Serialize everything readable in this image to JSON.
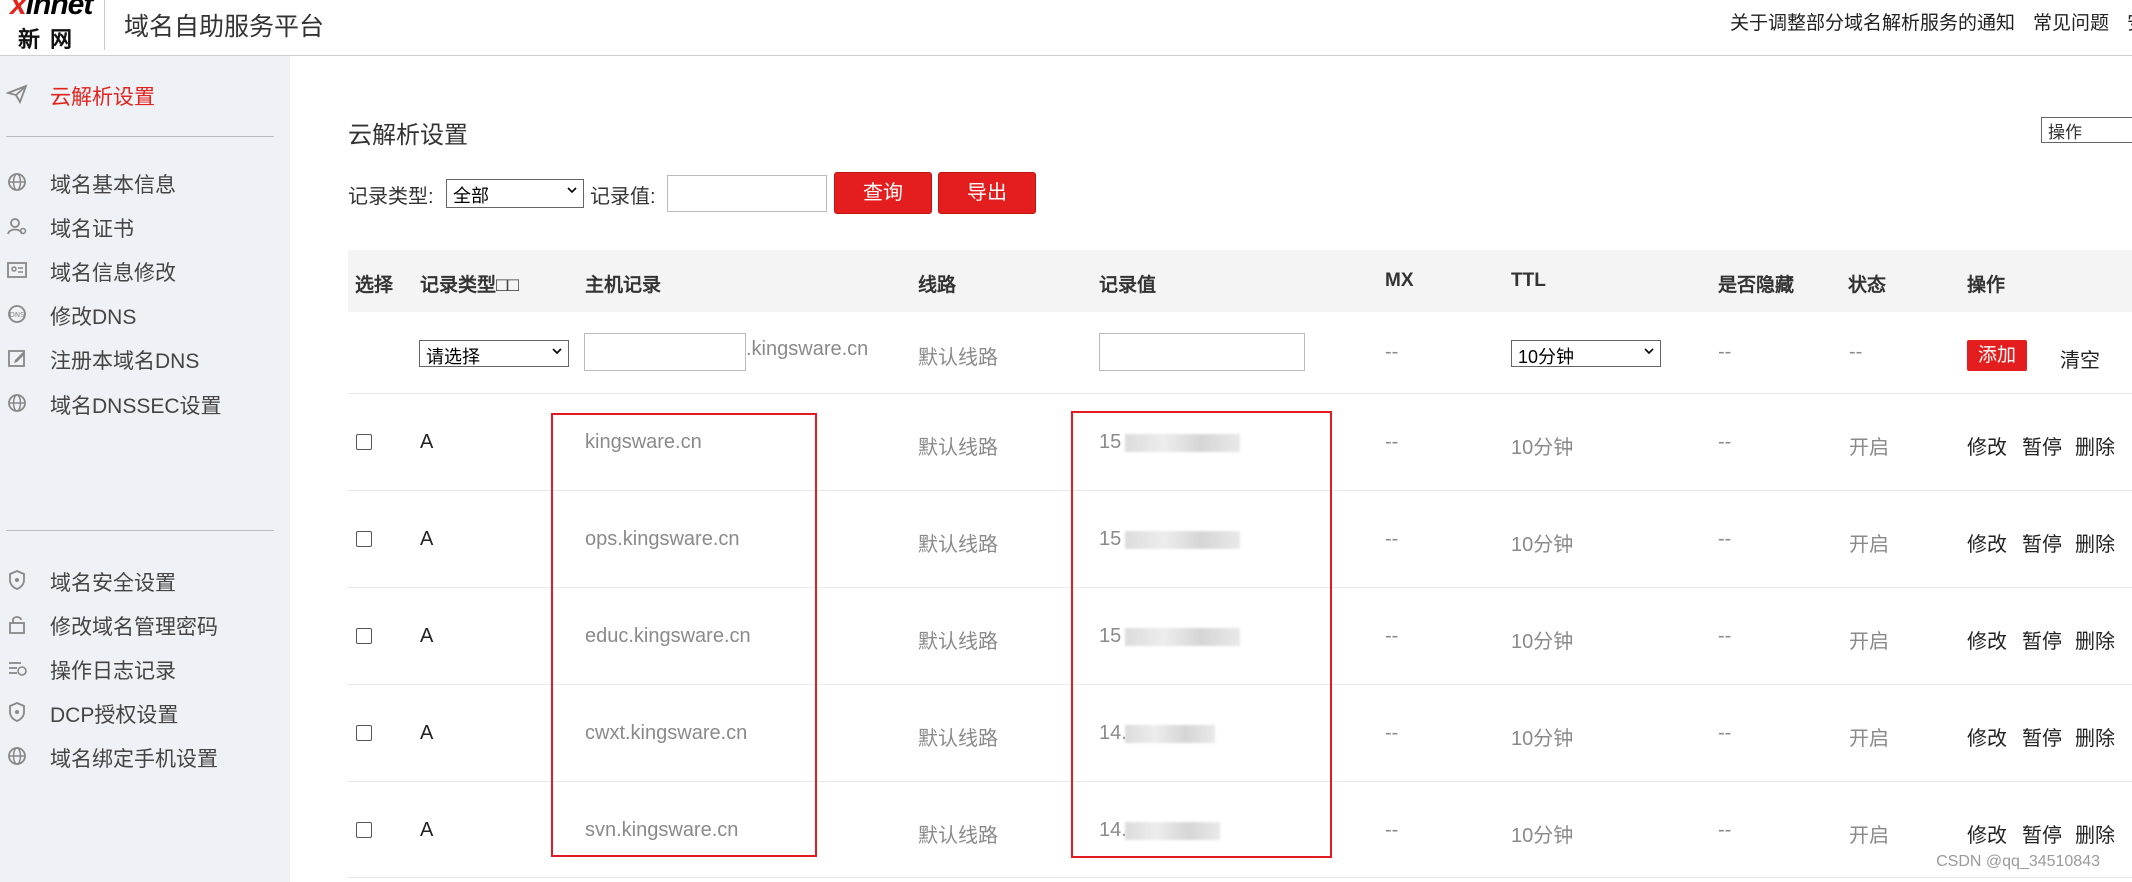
{
  "header": {
    "logo_brand": "xinnet",
    "logo_cn": "新网",
    "title": "域名自助服务平台",
    "links": [
      "关于调整部分域名解析服务的通知",
      "常见问题",
      "安"
    ]
  },
  "sidebar": {
    "items": [
      {
        "label": "云解析设置",
        "icon": "paper-plane-icon",
        "active": true
      },
      {
        "label": "域名基本信息",
        "icon": "globe-icon"
      },
      {
        "label": "域名证书",
        "icon": "user-cert-icon"
      },
      {
        "label": "域名信息修改",
        "icon": "id-card-icon"
      },
      {
        "label": "修改DNS",
        "icon": "dns-icon"
      },
      {
        "label": "注册本域名DNS",
        "icon": "edit-icon"
      },
      {
        "label": "域名DNSSEC设置",
        "icon": "globe-icon"
      },
      {
        "label": "域名安全设置",
        "icon": "shield-icon"
      },
      {
        "label": "修改域名管理密码",
        "icon": "lock-icon"
      },
      {
        "label": "操作日志记录",
        "icon": "log-list-icon"
      },
      {
        "label": "DCP授权设置",
        "icon": "shield-icon"
      },
      {
        "label": "域名绑定手机设置",
        "icon": "globe-icon"
      }
    ]
  },
  "main": {
    "title": "云解析设置",
    "operation_select": "操作",
    "filter": {
      "type_label": "记录类型:",
      "type_value": "全部",
      "value_label": "记录值:",
      "value_input": "",
      "query_button": "查询",
      "export_button": "导出"
    },
    "table": {
      "headers": [
        "选择",
        "记录类型",
        "主机记录",
        "线路",
        "记录值",
        "MX",
        "TTL",
        "是否隐藏",
        "状态",
        "操作"
      ],
      "header_suffix": "□□",
      "new_row": {
        "type_placeholder": "请选择",
        "host_suffix": ".kingsware.cn",
        "line": "默认线路",
        "mx": "--",
        "ttl": "10分钟",
        "hidden": "--",
        "status": "--",
        "add_button": "添加",
        "clear_button": "清空"
      },
      "rows": [
        {
          "type": "A",
          "host": "kingsware.cn",
          "line": "默认线路",
          "value": "15",
          "mx": "--",
          "ttl": "10分钟",
          "hidden": "--",
          "status": "开启"
        },
        {
          "type": "A",
          "host": "ops.kingsware.cn",
          "line": "默认线路",
          "value": "15",
          "mx": "--",
          "ttl": "10分钟",
          "hidden": "--",
          "status": "开启"
        },
        {
          "type": "A",
          "host": "educ.kingsware.cn",
          "line": "默认线路",
          "value": "15",
          "mx": "--",
          "ttl": "10分钟",
          "hidden": "--",
          "status": "开启"
        },
        {
          "type": "A",
          "host": "cwxt.kingsware.cn",
          "line": "默认线路",
          "value": "14.",
          "mx": "--",
          "ttl": "10分钟",
          "hidden": "--",
          "status": "开启"
        },
        {
          "type": "A",
          "host": "svn.kingsware.cn",
          "line": "默认线路",
          "value": "14.",
          "mx": "--",
          "ttl": "10分钟",
          "hidden": "--",
          "status": "开启"
        }
      ],
      "row_actions": [
        "修改",
        "暂停",
        "删除"
      ]
    }
  },
  "watermark": "CSDN @qq_34510843",
  "colors": {
    "accent": "#e41e1e",
    "sidebar_bg": "#eef1f6",
    "header_bg": "#f4f4f4",
    "highlight_box": "#e21a22"
  }
}
